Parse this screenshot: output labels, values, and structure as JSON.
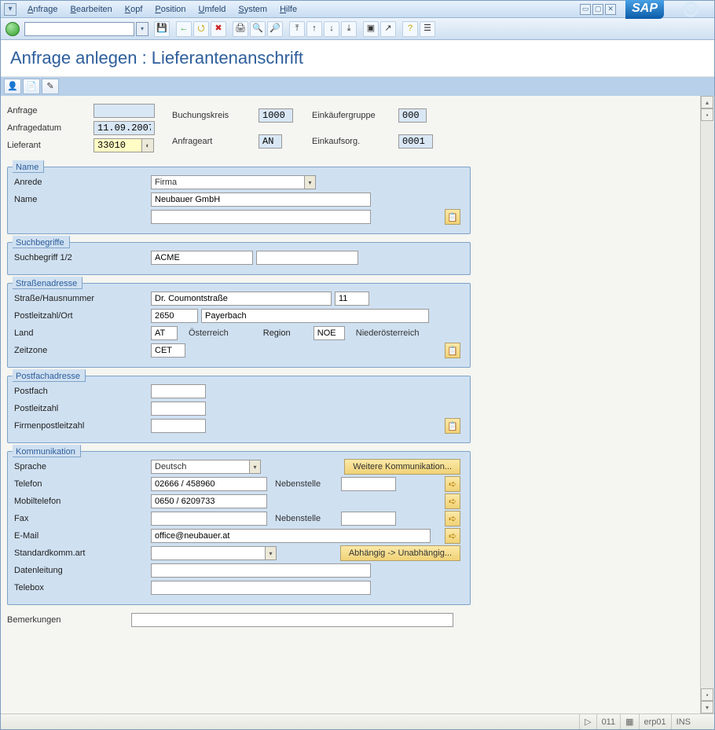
{
  "menu": {
    "items": [
      {
        "letter": "A",
        "rest": "nfrage"
      },
      {
        "letter": "B",
        "rest": "earbeiten"
      },
      {
        "letter": "K",
        "rest": "opf"
      },
      {
        "letter": "P",
        "rest": "osition"
      },
      {
        "letter": "U",
        "rest": "mfeld"
      },
      {
        "letter": "S",
        "rest": "ystem"
      },
      {
        "letter": "H",
        "rest": "ilfe"
      }
    ]
  },
  "title": "Anfrage anlegen : Lieferantenanschrift",
  "keyarea": {
    "anfrage_label": "Anfrage",
    "anfrage_value": "",
    "anfragedatum_label": "Anfragedatum",
    "anfragedatum_value": "11.09.2007",
    "lieferant_label": "Lieferant",
    "lieferant_value": "33010",
    "buchungskreis_label": "Buchungskreis",
    "buchungskreis_value": "1000",
    "anfrageart_label": "Anfrageart",
    "anfrageart_value": "AN",
    "einkgrp_label": "Einkäufergruppe",
    "einkgrp_value": "000",
    "einkorg_label": "Einkaufsorg.",
    "einkorg_value": "0001"
  },
  "name": {
    "title": "Name",
    "anrede_label": "Anrede",
    "anrede_value": "Firma",
    "name_label": "Name",
    "name_value": "Neubauer GmbH",
    "name2_value": ""
  },
  "search": {
    "title": "Suchbegriffe",
    "suchbegriff_label": "Suchbegriff 1/2",
    "suchbegriff1": "ACME",
    "suchbegriff2": ""
  },
  "street": {
    "title": "Straßenadresse",
    "street_label": "Straße/Hausnummer",
    "street_value": "Dr. Coumontstraße",
    "houseno_value": "11",
    "plzort_label": "Postleitzahl/Ort",
    "plz_value": "2650",
    "ort_value": "Payerbach",
    "land_label": "Land",
    "land_value": "AT",
    "land_text": "Österreich",
    "region_label": "Region",
    "region_value": "NOE",
    "region_text": "Niederösterreich",
    "zeitzone_label": "Zeitzone",
    "zeitzone_value": "CET"
  },
  "pobox": {
    "title": "Postfachadresse",
    "pf_label": "Postfach",
    "pf_value": "",
    "plz_label": "Postleitzahl",
    "plz_value": "",
    "firmplz_label": "Firmenpostleitzahl",
    "firmplz_value": ""
  },
  "comm": {
    "title": "Kommunikation",
    "sprache_label": "Sprache",
    "sprache_value": "Deutsch",
    "more_btn": "Weitere Kommunikation...",
    "tel_label": "Telefon",
    "tel_value": "02666 / 458960",
    "nebenstelle_label": "Nebenstelle",
    "tel_ext": "",
    "mobil_label": "Mobiltelefon",
    "mobil_value": "0650 / 6209733",
    "fax_label": "Fax",
    "fax_value": "",
    "fax_ext": "",
    "email_label": "E-Mail",
    "email_value": "office@neubauer.at",
    "stdkomm_label": "Standardkomm.art",
    "stdkomm_value": "",
    "abhaengig_btn": "Abhängig -> Unabhängig...",
    "dataline_label": "Datenleitung",
    "dataline_value": "",
    "telebox_label": "Telebox",
    "telebox_value": ""
  },
  "remarks_label": "Bemerkungen",
  "status": {
    "col": "011",
    "sys": "erp01",
    "mode": "INS"
  }
}
